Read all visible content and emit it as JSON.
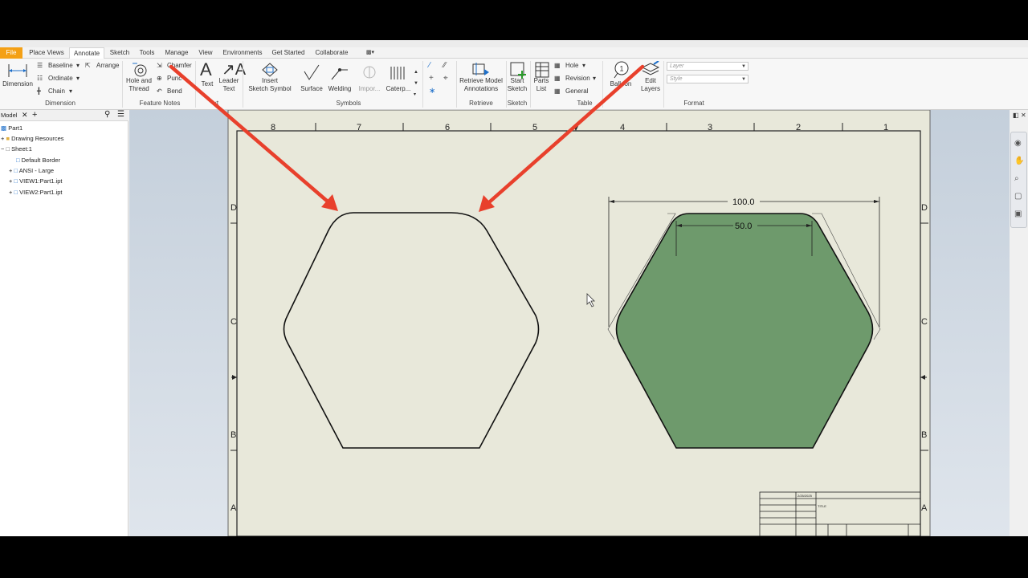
{
  "tabs": [
    "File",
    "Place Views",
    "Annotate",
    "Sketch",
    "Tools",
    "Manage",
    "View",
    "Environments",
    "Get Started",
    "Collaborate"
  ],
  "ribbon": {
    "dimension": "Dimension",
    "baseline": "Baseline",
    "ordinate": "Ordinate",
    "chain": "Chain",
    "arrange": "Arrange",
    "hole_and": "Hole and",
    "thread": "Thread",
    "chamfer": "Chamfer",
    "punch": "Punc",
    "bend": "Bend",
    "text": "Text",
    "leader": "Leader",
    "leader_text": "Text",
    "insert": "Insert",
    "sketch_symbol": "Sketch Symbol",
    "surface": "Surface",
    "welding": "Welding",
    "import": "Impor...",
    "caterpillar": "Caterp...",
    "retrieve_model": "Retrieve Model",
    "annotations": "Annotations",
    "start": "Start",
    "sketch": "Sketch",
    "parts": "Parts",
    "list": "List",
    "hole": "Hole",
    "revision": "Revision",
    "general": "General",
    "balloon": "Balloon",
    "edit": "Edit",
    "layers": "Layers",
    "layer_placeholder": "Layer",
    "style_placeholder": "Style"
  },
  "groups": {
    "dimension": "Dimension",
    "feature_notes": "Feature Notes",
    "text": "xt",
    "symbols": "Symbols",
    "retrieve": "Retrieve",
    "sketch": "Sketch",
    "table": "Table",
    "format": "Format"
  },
  "browser": {
    "tab": "Model",
    "items": [
      "Part1",
      "Drawing Resources",
      "Sheet:1",
      "Default Border",
      "ANSI - Large",
      "VIEW1:Part1.ipt",
      "VIEW2:Part1.ipt"
    ]
  },
  "sheet": {
    "columns": [
      "8",
      "7",
      "6",
      "5",
      "4",
      "3",
      "2",
      "1"
    ],
    "rows_left": [
      "D",
      "C",
      "B",
      "A"
    ],
    "rows_right": [
      "D",
      "C",
      "B",
      "A"
    ],
    "dim_outer": "100.0",
    "dim_inner": "50.0",
    "title_block": {
      "date": "2/25/2025",
      "title": "TITLE"
    }
  },
  "colors": {
    "arrow": "#e8402c",
    "fill": "#6e9a6c",
    "sheet": "#e8e8da",
    "file_tab": "#f4a015"
  }
}
